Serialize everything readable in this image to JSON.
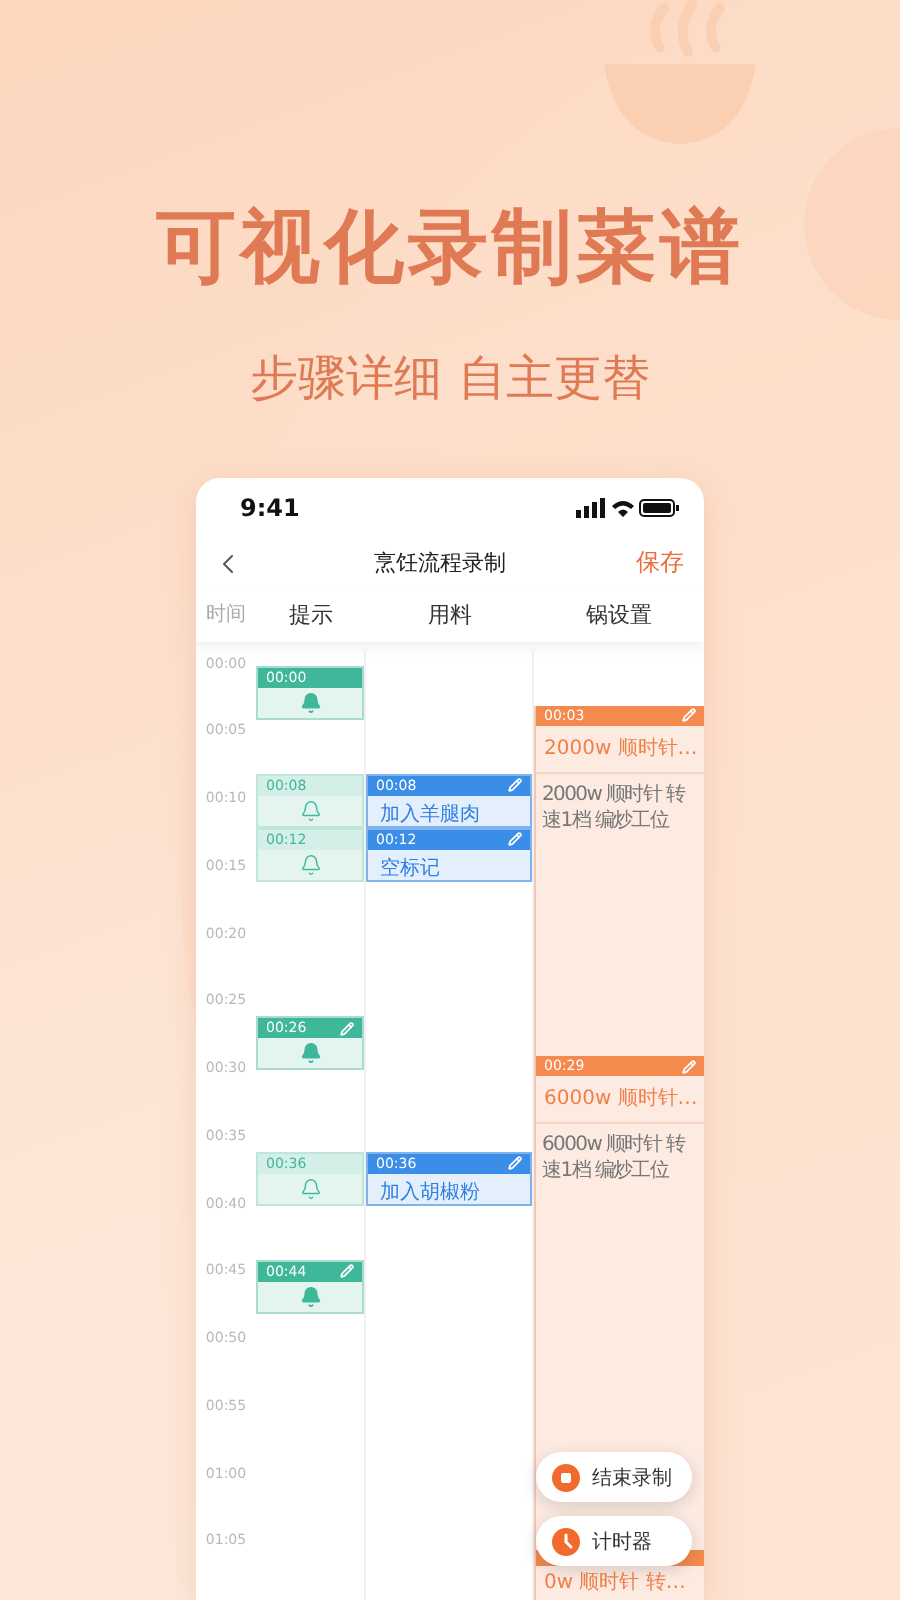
{
  "headline": "可视化录制菜谱",
  "subheadline": "步骤详细 自主更替",
  "phone": {
    "time": "9:41",
    "title": "烹饪流程录制",
    "save": "保存",
    "columns": [
      "时间",
      "提示",
      "用料",
      "锅设置"
    ],
    "ticks": [
      "00:00",
      "00:05",
      "00:10",
      "00:15",
      "00:20",
      "00:25",
      "00:30",
      "00:35",
      "00:40",
      "00:45",
      "00:50",
      "00:55",
      "01:00",
      "01:05"
    ],
    "tips": [
      {
        "time": "00:00",
        "filled": true,
        "editable": false
      },
      {
        "time": "00:08",
        "filled": false,
        "editable": false
      },
      {
        "time": "00:12",
        "filled": false,
        "editable": false
      },
      {
        "time": "00:26",
        "filled": true,
        "editable": true
      },
      {
        "time": "00:36",
        "filled": false,
        "editable": false
      },
      {
        "time": "00:44",
        "filled": true,
        "editable": true
      }
    ],
    "ingredients": [
      {
        "time": "00:08",
        "name": "加入羊腿肉"
      },
      {
        "time": "00:12",
        "name": "空标记"
      },
      {
        "time": "00:36",
        "name": "加入胡椒粉"
      }
    ],
    "pot": [
      {
        "time": "00:03",
        "title": "2000w 顺时针…",
        "detail": "2000w 顺时针 转速1档 编炒工位"
      },
      {
        "time": "00:29",
        "title": "6000w 顺时针…",
        "detail": "6000w 顺时针 转速1档 编炒工位"
      },
      {
        "title": "0w 顺时针 转…"
      }
    ],
    "actions": [
      {
        "kind": "stop",
        "label": "结束录制"
      },
      {
        "kind": "timer",
        "label": "计时器"
      }
    ]
  }
}
